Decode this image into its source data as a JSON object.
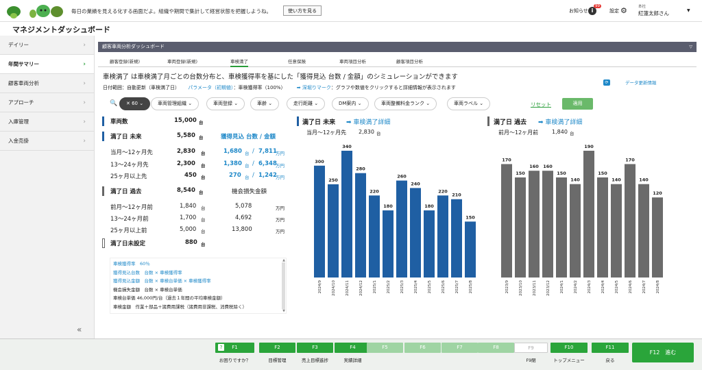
{
  "topbar": {
    "message": "毎日の業績を見える化する画面だよ。組織や期間で集計して経営状態を把握しようね。",
    "howto_label": "使い方を見る",
    "notice_label": "お知らせ",
    "notice_count": "99",
    "settings_label": "設定",
    "user_role": "本社",
    "user_name": "紅蓮太郎さん"
  },
  "page_title": "マネジメントダッシュボード",
  "sidebar": {
    "items": [
      {
        "label": "デイリー"
      },
      {
        "label": "年間サマリー"
      },
      {
        "label": "顧客車両分析"
      },
      {
        "label": "アプローチ"
      },
      {
        "label": "入庫管理"
      },
      {
        "label": "入金売掛"
      }
    ]
  },
  "section_title": "顧客車両分析ダッシュボード",
  "tabs": [
    "顧客登録(新規)",
    "車両登録(新規)",
    "車検満了",
    "任意保険",
    "車両項目分析",
    "顧客項目分析"
  ],
  "headline": "車検満了 は車検満了月ごとの台数分布と、車検獲得率を基にした「獲得見込 台数 / 金額」のシミュレーションができます",
  "subline": {
    "range": "日付範囲：自動更新（車検満了日）",
    "param_label": "パラメータ（初期値）",
    "param_value": "：車検獲得率（100%）",
    "drill": "➡ 深堀りマーク",
    "drill_desc": "：グラフや数値をクリックすると詳細情報が表示されます"
  },
  "refresh_label": "データ更新情報",
  "filters": {
    "count_chip": "✕ 60 ⌄",
    "chips": [
      "車両管理組織 ⌄",
      "車両登録 ⌄",
      "車齢 ⌄",
      "走行距離 ⌄",
      "DM案内 ⌄",
      "車両整備料金ランク ⌄",
      "車両ラベル ⌄"
    ],
    "reset": "リセット",
    "apply": "適用"
  },
  "stats": {
    "total_label": "車両数",
    "total_value": "15,000",
    "unit": "台",
    "future_label": "満了日 未来",
    "future_value": "5,580",
    "prospect_header": "獲得見込 台数 / 金額",
    "future_rows": [
      {
        "label": "当月〜12ヶ月先",
        "value": "2,830",
        "count": "1,680",
        "amount": "7,811"
      },
      {
        "label": "13〜24ヶ月先",
        "value": "2,300",
        "count": "1,380",
        "amount": "6,348"
      },
      {
        "label": "25ヶ月以上先",
        "value": "450",
        "count": "270",
        "amount": "1,242"
      }
    ],
    "yen_unit": "万円",
    "past_label": "満了日 過去",
    "past_value": "8,540",
    "loss_header": "機会損失金額",
    "past_rows": [
      {
        "label": "前月〜12ヶ月前",
        "value": "1,840",
        "loss": "5,078"
      },
      {
        "label": "13〜24ヶ月前",
        "value": "1,700",
        "loss": "4,692"
      },
      {
        "label": "25ヶ月以上前",
        "value": "5,000",
        "loss": "13,800"
      }
    ],
    "unset_label": "満了日未設定",
    "unset_value": "880"
  },
  "notes": [
    "車検獲得率　60％",
    "獲得見込台数　台数 × 車検獲得率",
    "獲得見込金額　台数 × 車検台単価 × 車検獲得率",
    "機会損失金額　台数 × 車検台単価",
    "車検台単価 46,000円/台（過去１年間の平均車検金額）",
    "車検金額　作業＋部品＋諸費用課税（諸費用非課税、消費税除く）"
  ],
  "chart_future_header": {
    "title": "満了日 未来",
    "link": "➡ 車検満了詳細",
    "sub_label": "当月〜12ヶ月先",
    "sub_value": "2,830",
    "sub_unit": "台"
  },
  "chart_past_header": {
    "title": "満了日 過去",
    "link": "➡ 車検満了詳細",
    "sub_label": "前月〜12ヶ月前",
    "sub_value": "1,840",
    "sub_unit": "台"
  },
  "chart_data": [
    {
      "type": "bar",
      "title": "満了日 未来",
      "categories": [
        "2024/9",
        "2024/10",
        "2024/11",
        "2024/12",
        "2025/1",
        "2025/2",
        "2025/3",
        "2025/4",
        "2025/5",
        "2025/6",
        "2025/7",
        "2025/8"
      ],
      "values": [
        300,
        250,
        340,
        280,
        220,
        180,
        260,
        240,
        180,
        220,
        210,
        150
      ],
      "ylim": [
        0,
        340
      ],
      "color": "#1f5fa3"
    },
    {
      "type": "bar",
      "title": "満了日 過去",
      "categories": [
        "2023/9",
        "2023/10",
        "2023/11",
        "2023/12",
        "2024/1",
        "2024/2",
        "2024/3",
        "2024/4",
        "2024/5",
        "2024/6",
        "2024/7",
        "2024/8"
      ],
      "values": [
        170,
        150,
        160,
        160,
        150,
        140,
        190,
        150,
        140,
        170,
        140,
        120
      ],
      "ylim": [
        0,
        190
      ],
      "color": "#6b6b6b"
    }
  ],
  "footer": {
    "keys": [
      {
        "key": "F1",
        "caption": "お困りですか？",
        "state": "on"
      },
      {
        "key": "F2",
        "caption": "目標管理",
        "state": "on"
      },
      {
        "key": "F3",
        "caption": "売上目標進捗",
        "state": "on"
      },
      {
        "key": "F4",
        "caption": "実績詳細",
        "state": "on"
      },
      {
        "key": "F5",
        "caption": "",
        "state": "off"
      },
      {
        "key": "F6",
        "caption": "",
        "state": "off"
      },
      {
        "key": "F7",
        "caption": "",
        "state": "off"
      },
      {
        "key": "F8",
        "caption": "",
        "state": "off"
      },
      {
        "key": "F9",
        "caption": "F9閉",
        "state": "plain"
      },
      {
        "key": "F10",
        "caption": "トップメニュー",
        "state": "on"
      },
      {
        "key": "F11",
        "caption": "戻る",
        "state": "on"
      }
    ],
    "f12": "F12　進む"
  }
}
